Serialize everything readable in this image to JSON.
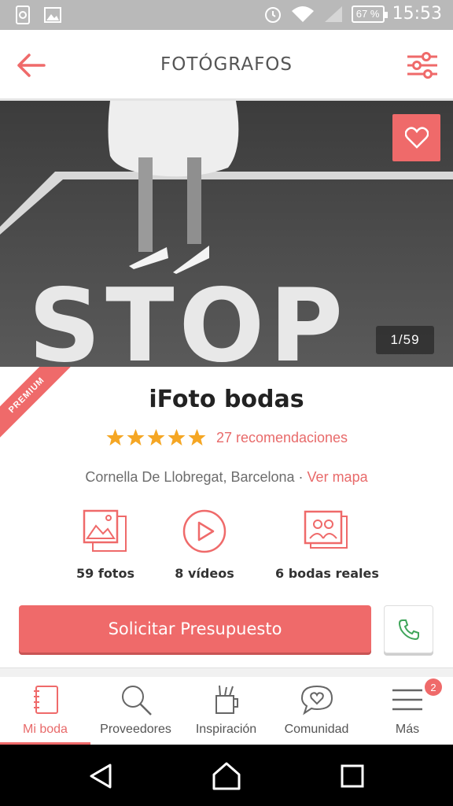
{
  "status_bar": {
    "battery": "67 %",
    "time": "15:53"
  },
  "header": {
    "title": "FOTÓGRAFOS"
  },
  "hero": {
    "photo_counter": "1/59",
    "photo_text": "STOP"
  },
  "vendor": {
    "premium_label": "PREMIUM",
    "name": "iFoto bodas",
    "rating": 5,
    "recommendations": "27 recomendaciones",
    "location": "Cornella De Llobregat, Barcelona · ",
    "map_link": "Ver mapa"
  },
  "stats": [
    {
      "label": "59 fotos",
      "icon": "photos-icon"
    },
    {
      "label": "8 vídeos",
      "icon": "play-icon"
    },
    {
      "label": "6 bodas reales",
      "icon": "couple-photos-icon"
    }
  ],
  "actions": {
    "quote_label": "Solicitar Presupuesto"
  },
  "bottom_nav": [
    {
      "label": "Mi boda",
      "icon": "notebook-icon",
      "active": true
    },
    {
      "label": "Proveedores",
      "icon": "search-icon"
    },
    {
      "label": "Inspiración",
      "icon": "cup-icon"
    },
    {
      "label": "Comunidad",
      "icon": "chat-heart-icon"
    },
    {
      "label": "Más",
      "icon": "menu-icon",
      "badge": "2"
    }
  ],
  "colors": {
    "accent": "#ef6a6a",
    "call_green": "#3fa55a",
    "star": "#f5a623"
  }
}
